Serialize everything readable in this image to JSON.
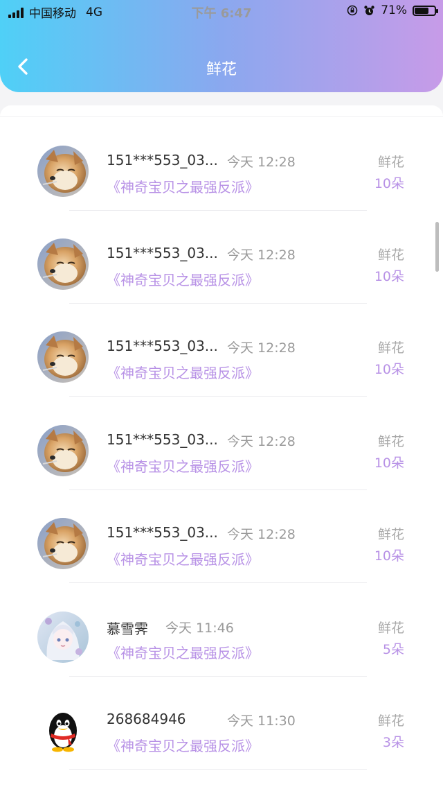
{
  "status_bar": {
    "carrier": "中国移动",
    "network": "4G",
    "time": "下午 6:47",
    "battery": "71%",
    "battery_level": 0.71
  },
  "header": {
    "title": "鲜花",
    "back_icon": "chevron-left-icon",
    "gradient": [
      "#4fd0f7",
      "#c79be8"
    ]
  },
  "colors": {
    "accent": "#b892e6",
    "muted": "#a8a8a8"
  },
  "list": [
    {
      "name": "151***553_03...",
      "time": "今天 12:28",
      "book": "《神奇宝贝之最强反派》",
      "gift_label": "鲜花",
      "count": "10朵",
      "avatar": "shiba-dog-avatar"
    },
    {
      "name": "151***553_03...",
      "time": "今天 12:28",
      "book": "《神奇宝贝之最强反派》",
      "gift_label": "鲜花",
      "count": "10朵",
      "avatar": "shiba-dog-avatar"
    },
    {
      "name": "151***553_03...",
      "time": "今天 12:28",
      "book": "《神奇宝贝之最强反派》",
      "gift_label": "鲜花",
      "count": "10朵",
      "avatar": "shiba-dog-avatar"
    },
    {
      "name": "151***553_03...",
      "time": "今天 12:28",
      "book": "《神奇宝贝之最强反派》",
      "gift_label": "鲜花",
      "count": "10朵",
      "avatar": "shiba-dog-avatar"
    },
    {
      "name": "151***553_03...",
      "time": "今天 12:28",
      "book": "《神奇宝贝之最强反派》",
      "gift_label": "鲜花",
      "count": "10朵",
      "avatar": "shiba-dog-avatar"
    },
    {
      "name": "慕雪霁",
      "time": "今天 11:46",
      "book": "《神奇宝贝之最强反派》",
      "gift_label": "鲜花",
      "count": "5朵",
      "avatar": "anime-girl-avatar"
    },
    {
      "name": "268684946",
      "time": "今天 11:30",
      "book": "《神奇宝贝之最强反派》",
      "gift_label": "鲜花",
      "count": "3朵",
      "avatar": "qq-penguin-avatar"
    }
  ]
}
